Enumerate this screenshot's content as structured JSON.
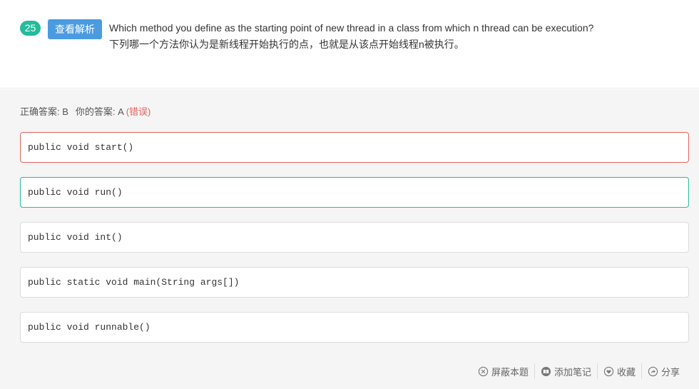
{
  "question": {
    "number": "25",
    "explain_button": "查看解析",
    "text_en": "Which method you define as the starting point of new thread in a class from which n thread can be execution?",
    "text_zh": "下列哪一个方法你认为是新线程开始执行的点，也就是从该点开始线程n被执行。"
  },
  "answer": {
    "correct_label": "正确答案: B",
    "yours_label": "你的答案: A",
    "result": "(错误)"
  },
  "options": [
    {
      "text": "public void start()",
      "state": "selected-wrong"
    },
    {
      "text": "public void run()",
      "state": "correct"
    },
    {
      "text": "public void int()",
      "state": "normal"
    },
    {
      "text": "public static void main(String args[])",
      "state": "normal"
    },
    {
      "text": "public void runnable()",
      "state": "normal"
    }
  ],
  "actions": {
    "hide": "屏蔽本题",
    "note": "添加笔记",
    "favorite": "收藏",
    "share": "分享"
  },
  "colors": {
    "accent_green": "#25bb9b",
    "button_blue": "#4a9be0",
    "error_red": "#e3625a"
  }
}
